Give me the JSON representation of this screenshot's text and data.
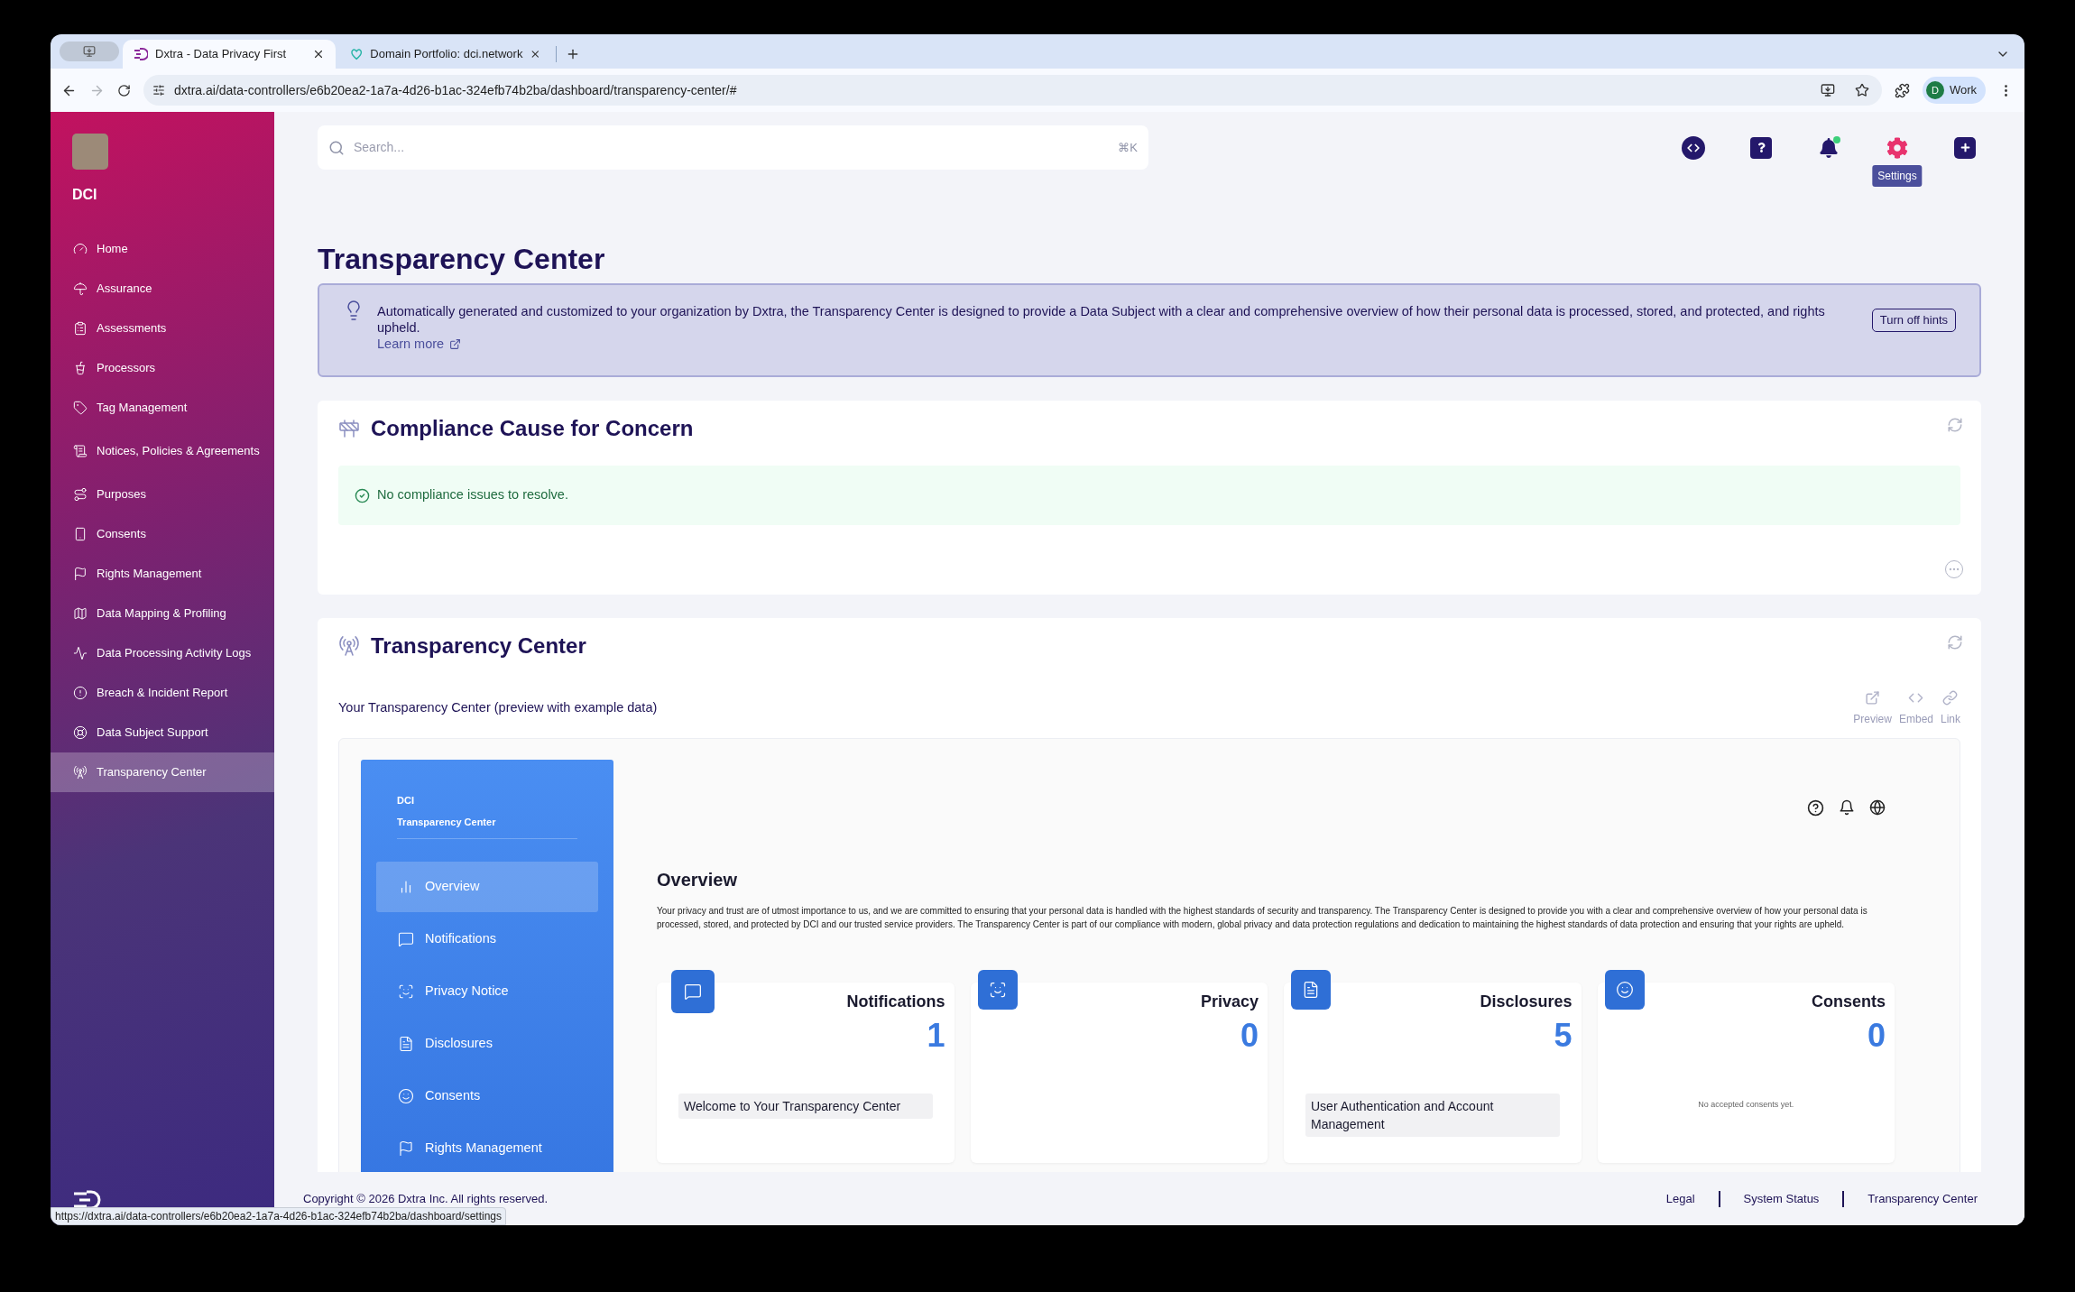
{
  "browser": {
    "tabs": [
      {
        "title": "Dxtra - Data Privacy First",
        "selected": true
      },
      {
        "title": "Domain Portfolio: dci.network",
        "selected": false
      }
    ],
    "can_go_forward": false,
    "url": "dxtra.ai/data-controllers/e6b20ea2-1a7a-4d26-b1ac-324efb74b2ba/dashboard/transparency-center/#",
    "profile": {
      "initial": "D",
      "name": "Work"
    },
    "status_url": "https://dxtra.ai/data-controllers/e6b20ea2-1a7a-4d26-b1ac-324efb74b2ba/dashboard/settings"
  },
  "sidebar": {
    "org": "DCI",
    "items": [
      {
        "label": "Home",
        "selected": false
      },
      {
        "label": "Assurance",
        "selected": false
      },
      {
        "label": "Assessments",
        "selected": false
      },
      {
        "label": "Processors",
        "selected": false
      },
      {
        "label": "Tag Management",
        "selected": false
      },
      {
        "label": "Notices, Policies & Agreements",
        "selected": false
      },
      {
        "label": "Purposes",
        "selected": false
      },
      {
        "label": "Consents",
        "selected": false
      },
      {
        "label": "Rights Management",
        "selected": false
      },
      {
        "label": "Data Mapping & Profiling",
        "selected": false
      },
      {
        "label": "Data Processing Activity Logs",
        "selected": false
      },
      {
        "label": "Breach & Incident Report",
        "selected": false
      },
      {
        "label": "Data Subject Support",
        "selected": false
      },
      {
        "label": "Transparency Center",
        "selected": true
      }
    ]
  },
  "header": {
    "search": {
      "placeholder": "Search...",
      "shortcut": "⌘K"
    },
    "notifications_unread": true,
    "tooltip": "Settings"
  },
  "page": {
    "title": "Transparency Center",
    "hint": {
      "text": "Automatically generated and customized to your organization by Dxtra, the Transparency Center is designed to provide a Data Subject with a clear and comprehensive overview of how their personal data is processed, stored, and protected, and rights upheld.",
      "link": "Learn more",
      "button": "Turn off hints"
    },
    "compliance": {
      "title": "Compliance Cause for Concern",
      "message": "No compliance issues to resolve."
    },
    "transparency": {
      "title": "Transparency Center",
      "subtitle": "Your Transparency Center (preview with example data)",
      "actions": [
        "Preview",
        "Embed",
        "Link"
      ]
    }
  },
  "preview": {
    "org": "DCI",
    "title": "Transparency Center",
    "nav": [
      {
        "label": "Overview",
        "selected": true
      },
      {
        "label": "Notifications",
        "selected": false
      },
      {
        "label": "Privacy Notice",
        "selected": false
      },
      {
        "label": "Disclosures",
        "selected": false
      },
      {
        "label": "Consents",
        "selected": false
      },
      {
        "label": "Rights Management",
        "selected": false
      }
    ],
    "heading": "Overview",
    "intro": "Your privacy and trust are of utmost importance to us, and we are committed to ensuring that your personal data is handled with the highest standards of security and transparency. The Transparency Center is designed to provide you with a clear and comprehensive overview of how your personal data is processed, stored, and protected by DCI and our trusted service providers. The Transparency Center is part of our compliance with modern, global privacy and data protection regulations and dedication to maintaining the highest standards of data protection and ensuring that your rights are upheld.",
    "cards": [
      {
        "title": "Notifications",
        "count": "1",
        "items": [
          "Welcome to Your Transparency Center"
        ]
      },
      {
        "title": "Privacy",
        "count": "0"
      },
      {
        "title": "Disclosures",
        "count": "5",
        "items": [
          "User Authentication and Account Management"
        ]
      },
      {
        "title": "Consents",
        "count": "0",
        "empty": "No accepted consents yet."
      }
    ]
  },
  "footer": {
    "copyright": "Copyright © 2026 Dxtra Inc. All rights reserved.",
    "links": [
      "Legal",
      "System Status",
      "Transparency Center"
    ]
  }
}
